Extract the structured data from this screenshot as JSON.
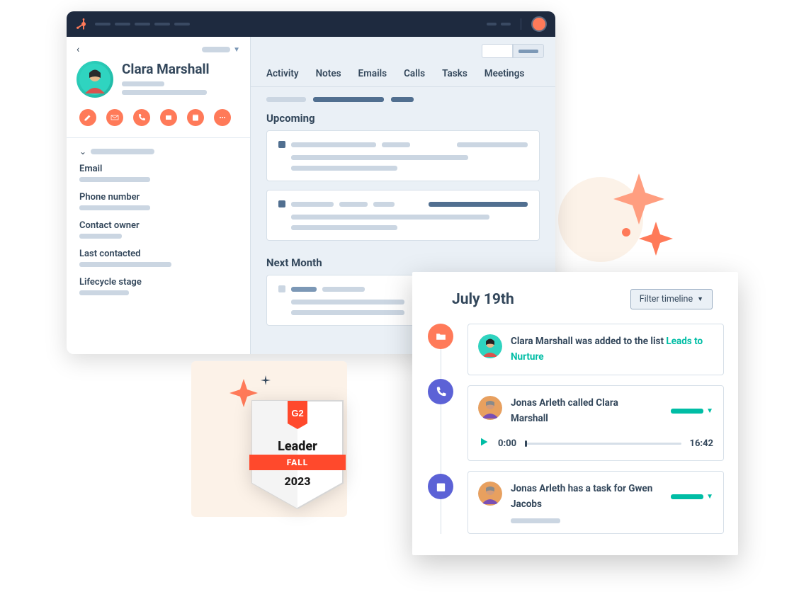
{
  "contact": {
    "name": "Clara Marshall"
  },
  "sidebar": {
    "fields": [
      {
        "label": "Email"
      },
      {
        "label": "Phone number"
      },
      {
        "label": "Contact owner"
      },
      {
        "label": "Last contacted"
      },
      {
        "label": "Lifecycle stage"
      }
    ]
  },
  "tabs": {
    "items": [
      {
        "label": "Activity"
      },
      {
        "label": "Notes"
      },
      {
        "label": "Emails"
      },
      {
        "label": "Calls"
      },
      {
        "label": "Tasks"
      },
      {
        "label": "Meetings"
      }
    ]
  },
  "sections": {
    "upcoming": "Upcoming",
    "next_month": "Next Month"
  },
  "timeline": {
    "date": "July 19th",
    "filter_label": "Filter timeline",
    "entries": [
      {
        "text_pre": "Clara Marshall was added to the list ",
        "link_text": "Leads to Nurture"
      },
      {
        "text": "Jonas Arleth called Clara Marshall",
        "player_start": "0:00",
        "player_end": "16:42"
      },
      {
        "text": "Jonas Arleth has a task for Gwen Jacobs"
      }
    ]
  },
  "badge": {
    "title": "Leader",
    "season": "FALL",
    "year": "2023"
  }
}
